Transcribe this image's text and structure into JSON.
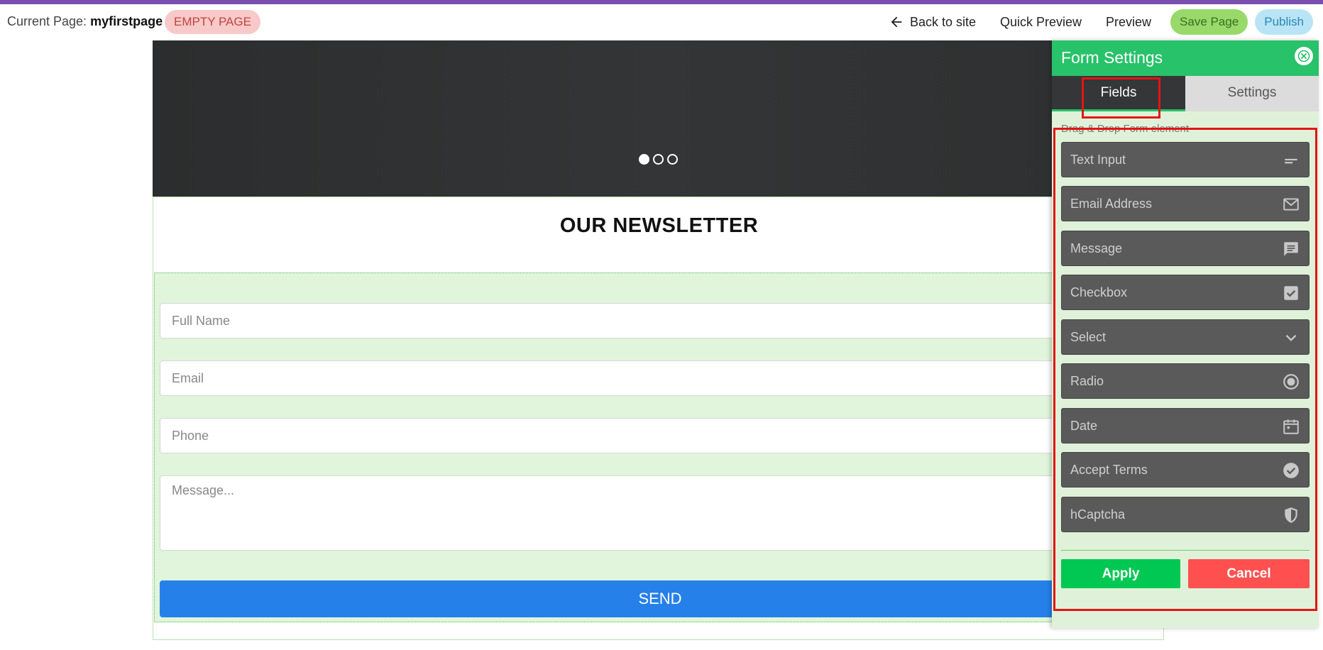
{
  "topbar": {
    "current_page_label": "Current Page:",
    "current_page_name": "myfirstpage",
    "status_badge": "EMPTY PAGE",
    "back_to_site": "Back to site",
    "quick_preview": "Quick Preview",
    "preview": "Preview",
    "save_page": "Save Page",
    "publish": "Publish"
  },
  "hero": {
    "slide_count": 3,
    "active_slide": 1
  },
  "newsletter": {
    "title": "OUR NEWSLETTER",
    "fields": {
      "full_name_placeholder": "Full Name",
      "email_placeholder": "Email",
      "phone_placeholder": "Phone",
      "message_placeholder": "Message..."
    },
    "send_label": "SEND"
  },
  "panel": {
    "title": "Form Settings",
    "tabs": {
      "fields": "Fields",
      "settings": "Settings"
    },
    "drag_drop_label": "Drag & Drop Form element",
    "elements": [
      {
        "label": "Text Input",
        "icon": "short-text-icon"
      },
      {
        "label": "Email Address",
        "icon": "envelope-icon"
      },
      {
        "label": "Message",
        "icon": "message-icon"
      },
      {
        "label": "Checkbox",
        "icon": "checkbox-icon"
      },
      {
        "label": "Select",
        "icon": "chevron-down-icon"
      },
      {
        "label": "Radio",
        "icon": "radio-icon"
      },
      {
        "label": "Date",
        "icon": "calendar-icon"
      },
      {
        "label": "Accept Terms",
        "icon": "check-circle-icon"
      },
      {
        "label": "hCaptcha",
        "icon": "shield-icon"
      }
    ],
    "apply_label": "Apply",
    "cancel_label": "Cancel"
  },
  "colors": {
    "topstrip": "#7b4fb0",
    "panel_header": "#28c26a",
    "apply": "#00c853",
    "cancel": "#ff5050",
    "send": "#2581e9",
    "highlight": "#e41414"
  }
}
